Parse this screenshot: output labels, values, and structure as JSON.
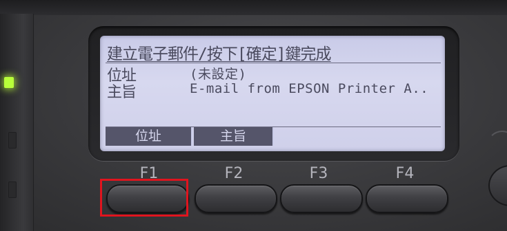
{
  "lcd": {
    "title": "建立電子郵件/按下[確定]鍵完成",
    "rows": [
      {
        "label": "位址",
        "value": "(未設定)"
      },
      {
        "label": "主旨",
        "value": "E-mail from EPSON Printer A.."
      }
    ],
    "softkeys": [
      "位址",
      "主旨"
    ]
  },
  "function_keys": [
    "F1",
    "F2",
    "F3",
    "F4"
  ],
  "colors": {
    "lcd_background": "#cfd0ea",
    "lcd_text": "#4a4a5e",
    "softkey_background": "#55556a",
    "status_led": "#b8ff3a",
    "highlight": "#e0141e"
  },
  "highlighted_key": "F1"
}
